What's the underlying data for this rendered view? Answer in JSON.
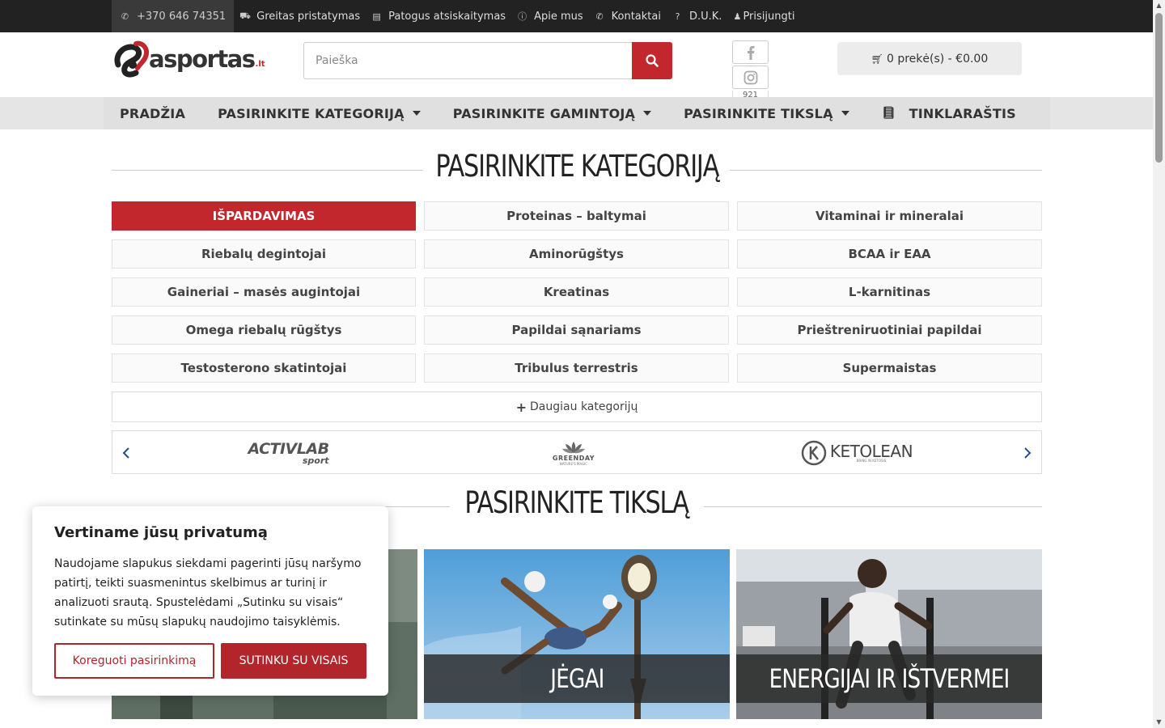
{
  "topbar": {
    "phone": "+370 646 74351",
    "links": [
      "Greitas pristatymas",
      "Patogus atsiskaitymas",
      "Apie mus",
      "Kontaktai",
      "D.U.K.",
      "Prisijungti"
    ]
  },
  "header": {
    "logo_text": "asportas",
    "logo_tld": ".lt",
    "search_placeholder": "Paieška",
    "instagram_count": "921",
    "cart_text": "0 prekė(s) - €0.00"
  },
  "nav": {
    "home": "PRADŽIA",
    "categories": "PASIRINKITE KATEGORIJĄ",
    "brands": "PASIRINKITE GAMINTOJĄ",
    "goals": "PASIRINKITE TIKSLĄ",
    "blog": "TINKLARAŠTIS"
  },
  "categories": {
    "title": "PASIRINKITE KATEGORIJĄ",
    "items": [
      "IŠPARDAVIMAS",
      "Proteinas – baltymai",
      "Vitaminai ir mineralai",
      "Riebalų degintojai",
      "Aminorūgštys",
      "BCAA ir EAA",
      "Gaineriai – masės augintojai",
      "Kreatinas",
      "L-karnitinas",
      "Omega riebalų rūgštys",
      "Papildai sąnariams",
      "Prieštreniruotiniai papildai",
      "Testosterono skatintojai",
      "Tribulus terrestris",
      "Supermaistas"
    ],
    "more": "Daugiau kategorijų"
  },
  "brands": {
    "items": [
      {
        "name": "ACTIVLAB",
        "sub": "sport"
      },
      {
        "name": "GREENDAY",
        "sub": "NATURE'S MAGIC"
      },
      {
        "name": "KETOLEAN",
        "sub": "BRING IN KETOSIS"
      }
    ]
  },
  "goals": {
    "title": "PASIRINKITE TIKSLĄ",
    "tiles": [
      "JĖGAI",
      "ENERGIJAI IR IŠTVERMEI"
    ]
  },
  "cookie": {
    "title": "Vertiname jūsų privatumą",
    "text": "Naudojame slapukus siekdami pagerinti jūsų naršymo patirtį, teikti suasmenintus skelbimus ar turinį ir analizuoti srautą. Spustelėdami „Sutinku su visais“ sutinkate su mūsų slapukų naudojimo taisyklėmis.",
    "btn_customize": "Koreguoti pasirinkimą",
    "btn_accept": "SUTINKU SU VISAIS"
  },
  "colors": {
    "brand_red": "#c1272d",
    "topbar": "#222222",
    "nav_bg": "#e0e0e0"
  }
}
